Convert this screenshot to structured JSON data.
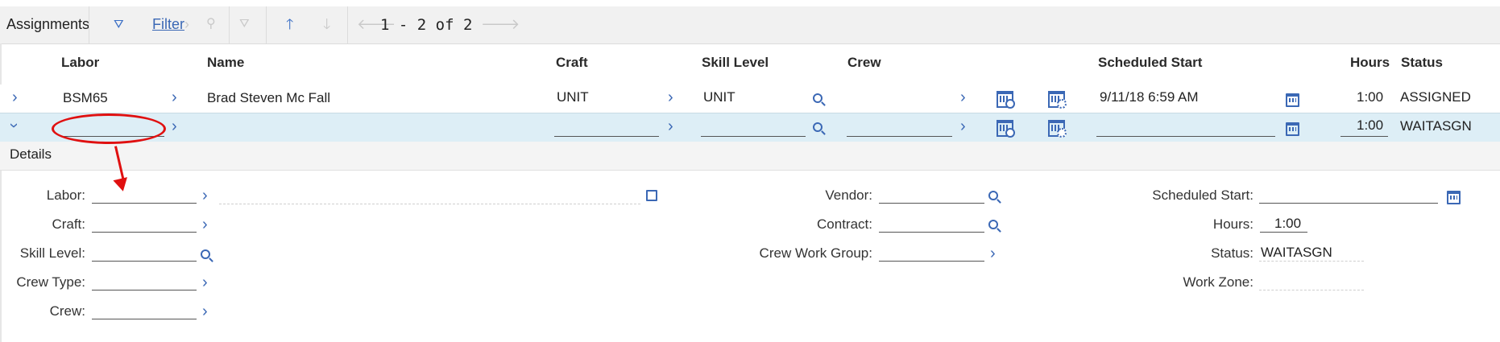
{
  "toolbar": {
    "title": "Assignments",
    "filter_label": "Filter",
    "pager": "1 - 2 of 2"
  },
  "columns": {
    "labor": "Labor",
    "name": "Name",
    "craft": "Craft",
    "skill_level": "Skill Level",
    "crew": "Crew",
    "scheduled_start": "Scheduled Start",
    "hours": "Hours",
    "status": "Status"
  },
  "rows": [
    {
      "labor": "BSM65",
      "name": "Brad Steven Mc Fall",
      "craft": "UNIT",
      "skill_level": "UNIT",
      "crew": "",
      "scheduled_start": "9/11/18 6:59 AM",
      "hours": "1:00",
      "status": "ASSIGNED"
    },
    {
      "labor": "",
      "name": "",
      "craft": "",
      "skill_level": "",
      "crew": "",
      "scheduled_start": "",
      "hours": "1:00",
      "status": "WAITASGN"
    }
  ],
  "details": {
    "title": "Details",
    "labor_label": "Labor:",
    "craft_label": "Craft:",
    "skill_level_label": "Skill Level:",
    "crew_type_label": "Crew Type:",
    "crew_label": "Crew:",
    "vendor_label": "Vendor:",
    "contract_label": "Contract:",
    "crew_work_group_label": "Crew Work Group:",
    "scheduled_start_label": "Scheduled Start:",
    "hours_label": "Hours:",
    "hours_value": "1:00",
    "status_label": "Status:",
    "status_value": "WAITASGN",
    "work_zone_label": "Work Zone:"
  },
  "colors": {
    "accent": "#3b68b5",
    "selected_row": "#ddeef6",
    "annotation": "#e01010"
  }
}
